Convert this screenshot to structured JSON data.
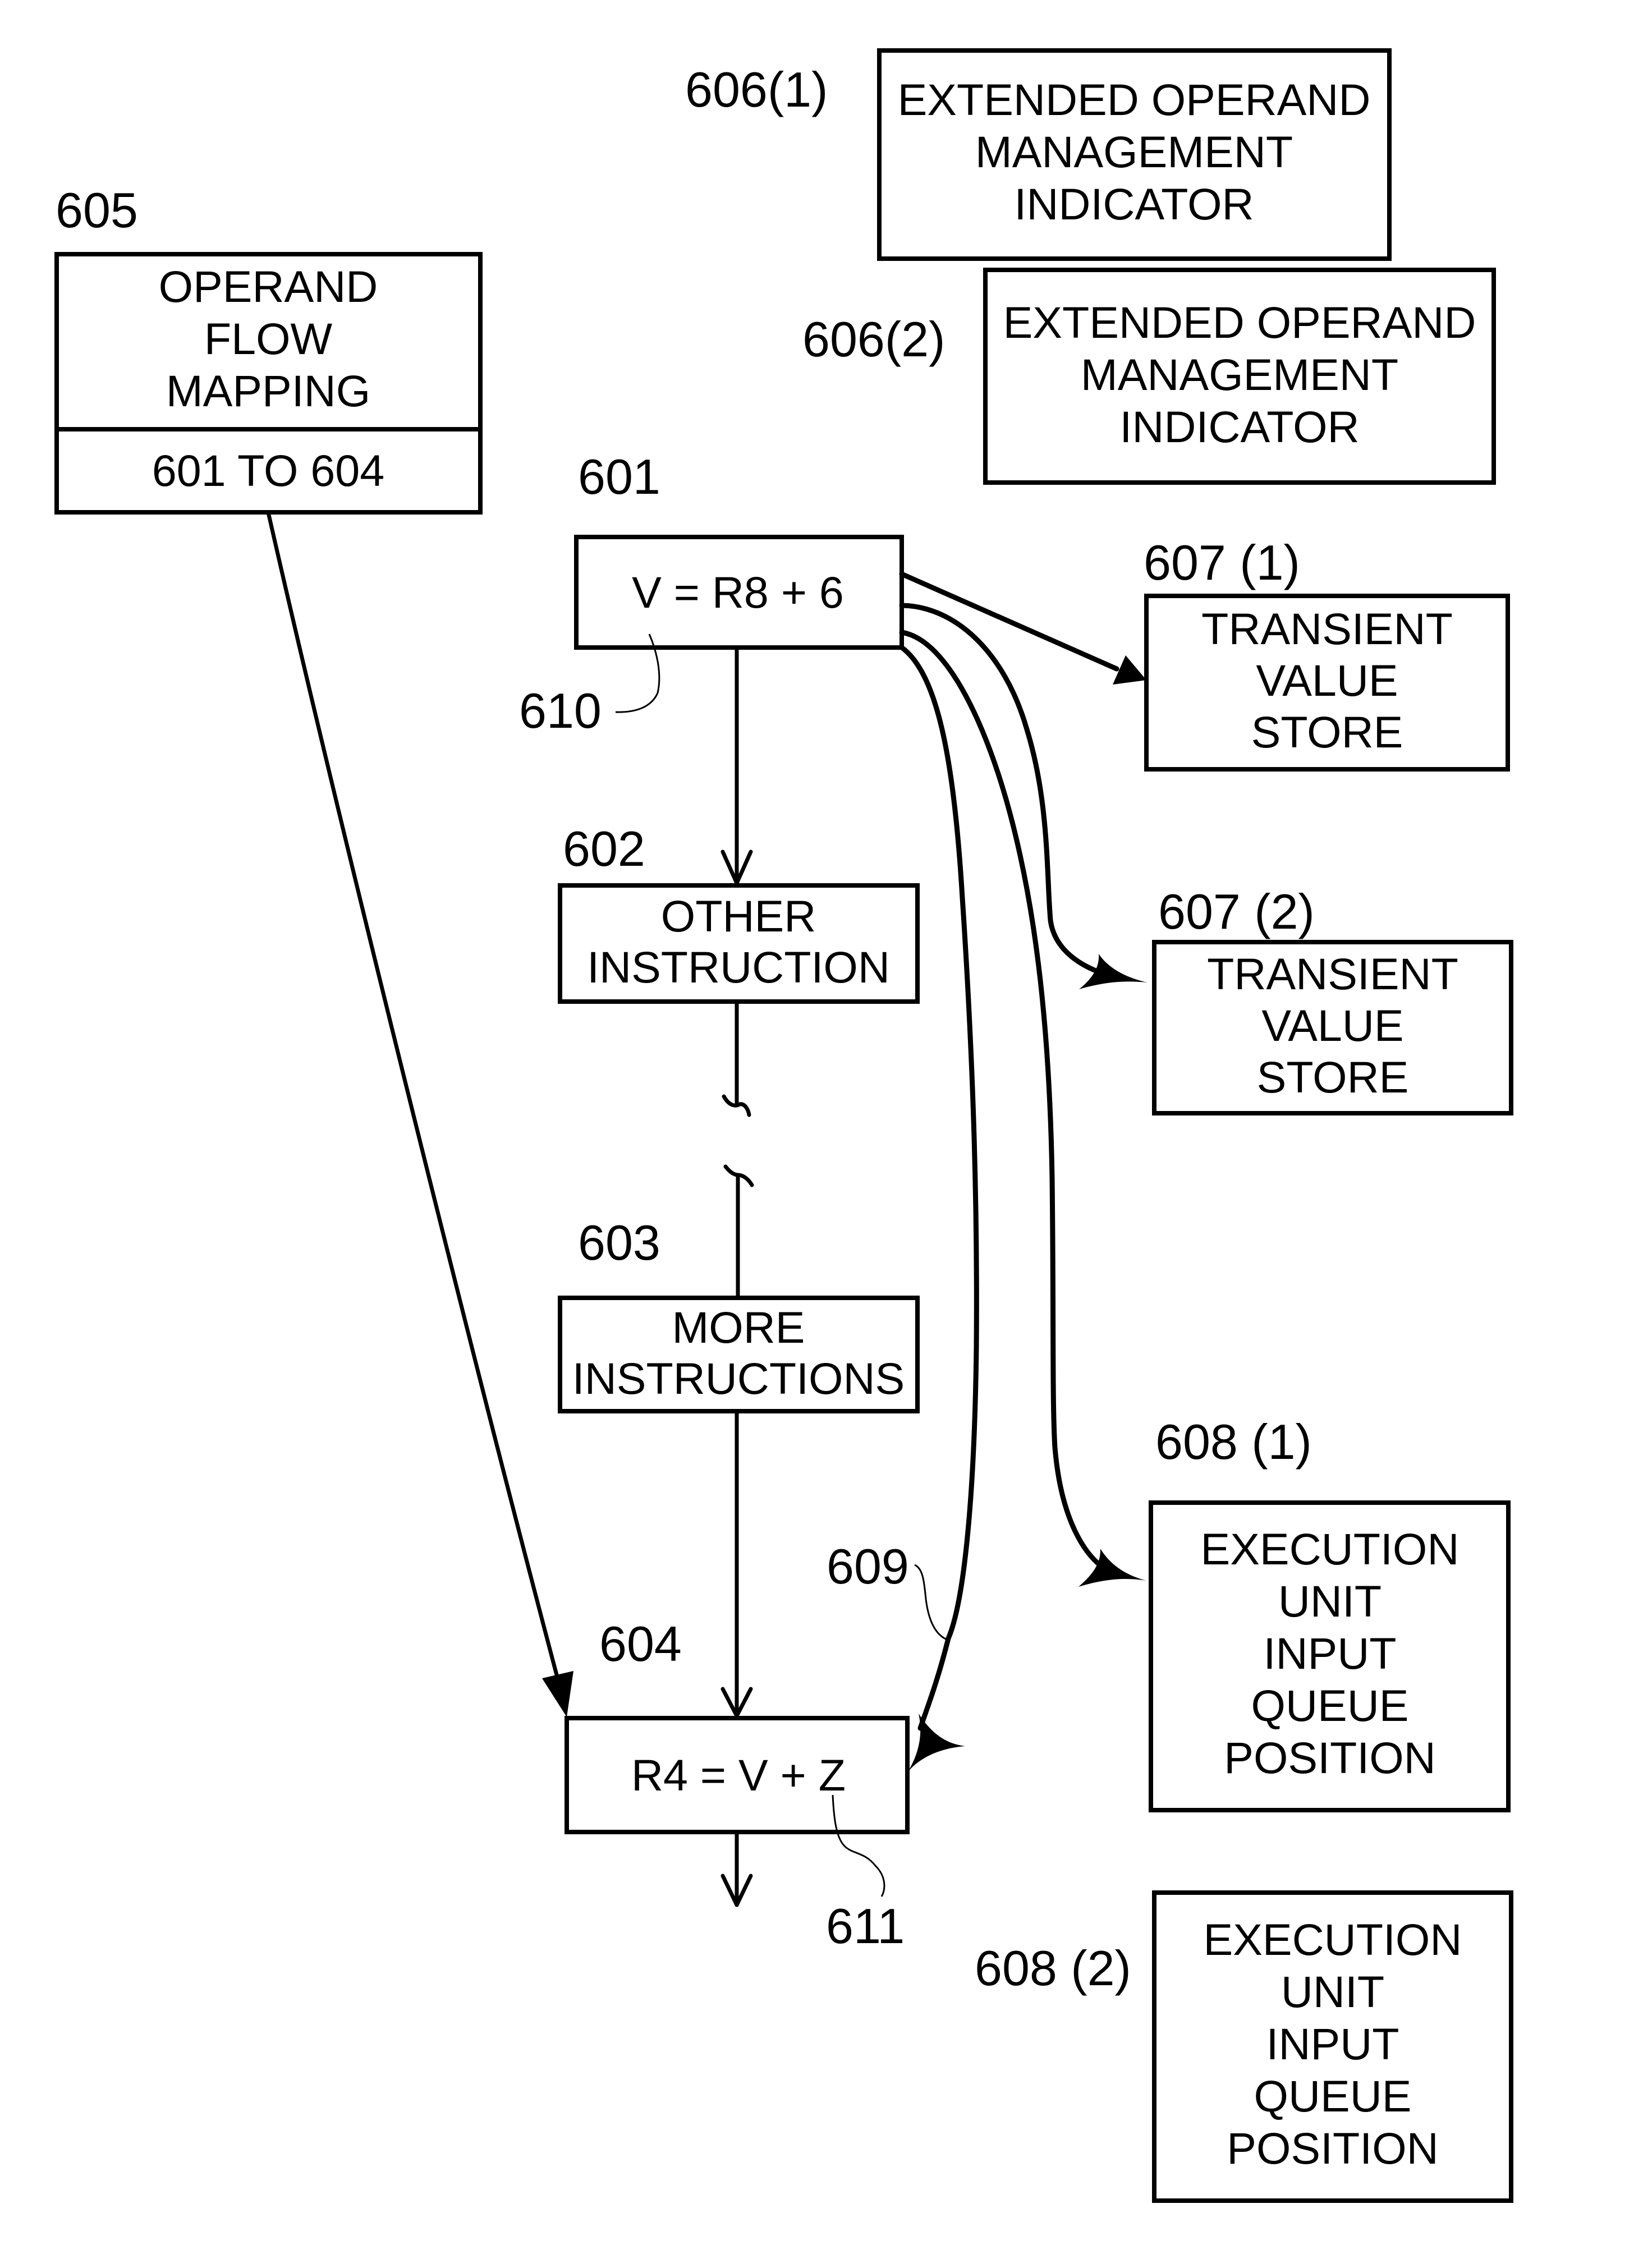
{
  "figure": {
    "boxes": {
      "b605": {
        "ref": "605",
        "lines": [
          "OPERAND",
          "FLOW",
          "MAPPING"
        ],
        "footer": "601 TO 604"
      },
      "b606_1": {
        "ref": "606(1)",
        "lines": [
          "EXTENDED OPERAND",
          "MANAGEMENT",
          "INDICATOR"
        ]
      },
      "b606_2": {
        "ref": "606(2)",
        "lines": [
          "EXTENDED OPERAND",
          "MANAGEMENT",
          "INDICATOR"
        ]
      },
      "b601": {
        "ref": "601",
        "lines": [
          "V = R8 + 6"
        ]
      },
      "b602": {
        "ref": "602",
        "lines": [
          "OTHER",
          "INSTRUCTION"
        ]
      },
      "b603": {
        "ref": "603",
        "lines": [
          "MORE",
          "INSTRUCTIONS"
        ]
      },
      "b604": {
        "ref": "604",
        "lines": [
          "R4 = V + Z"
        ]
      },
      "b607_1": {
        "ref": "607 (1)",
        "lines": [
          "TRANSIENT",
          "VALUE",
          "STORE"
        ]
      },
      "b607_2": {
        "ref": "607 (2)",
        "lines": [
          "TRANSIENT",
          "VALUE",
          "STORE"
        ]
      },
      "b608_1": {
        "ref": "608 (1)",
        "lines": [
          "EXECUTION",
          "UNIT",
          "INPUT",
          "QUEUE",
          "POSITION"
        ]
      },
      "b608_2": {
        "ref": "608 (2)",
        "lines": [
          "EXECUTION",
          "UNIT",
          "INPUT",
          "QUEUE",
          "POSITION"
        ]
      }
    },
    "leaders": {
      "l609": "609",
      "l610": "610",
      "l611": "611"
    },
    "connections": [
      {
        "from": "605",
        "to": "604",
        "type": "solid-arrow"
      },
      {
        "from": "601",
        "to": "602",
        "type": "open-arrow"
      },
      {
        "from": "602",
        "to": "603",
        "type": "line-break"
      },
      {
        "from": "603",
        "to": "604",
        "type": "open-arrow"
      },
      {
        "from": "604",
        "to": "next",
        "type": "open-arrow"
      },
      {
        "from": "601",
        "to": "607 (1)",
        "type": "solid-arrow"
      },
      {
        "from": "601",
        "to": "607 (2)",
        "type": "curved-arrow"
      },
      {
        "from": "601",
        "to": "608 (1)",
        "type": "curved-arrow"
      },
      {
        "from": "601",
        "to": "604",
        "type": "curved-arrow",
        "label": "609"
      }
    ]
  }
}
